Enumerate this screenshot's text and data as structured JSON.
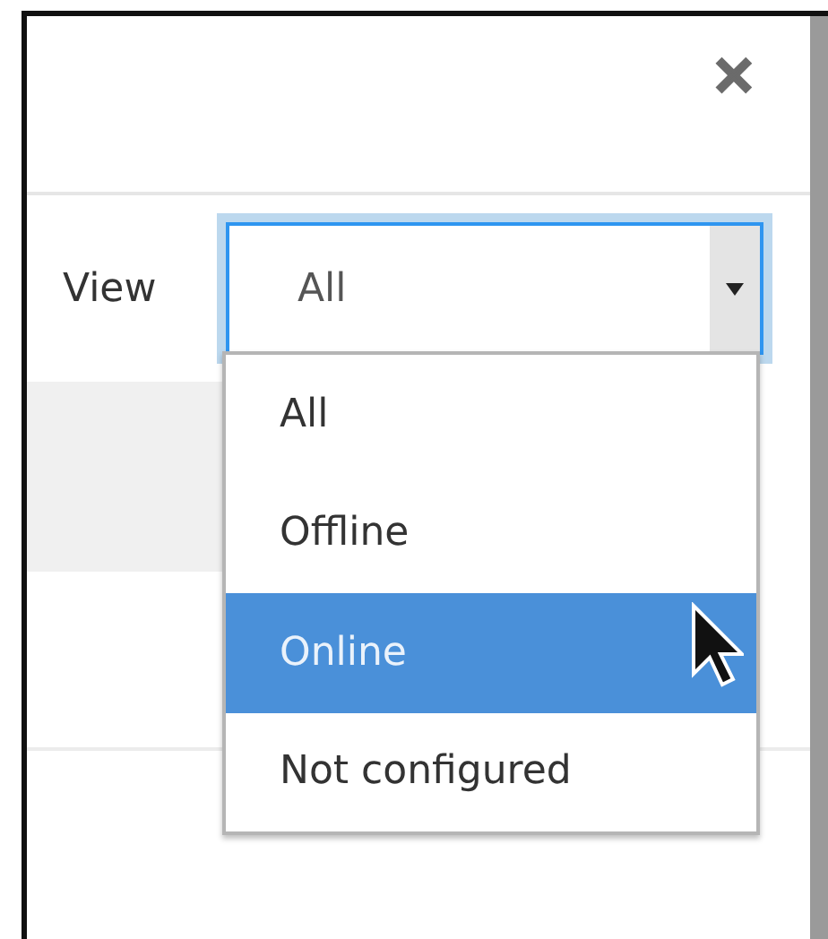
{
  "dialog": {
    "close": "✕"
  },
  "view_filter": {
    "label": "View",
    "value": "All",
    "expanded": true,
    "options": [
      {
        "label": "All",
        "highlighted": false
      },
      {
        "label": "Offline",
        "highlighted": false
      },
      {
        "label": "Online",
        "highlighted": true
      },
      {
        "label": "Not configured",
        "highlighted": false
      }
    ]
  }
}
